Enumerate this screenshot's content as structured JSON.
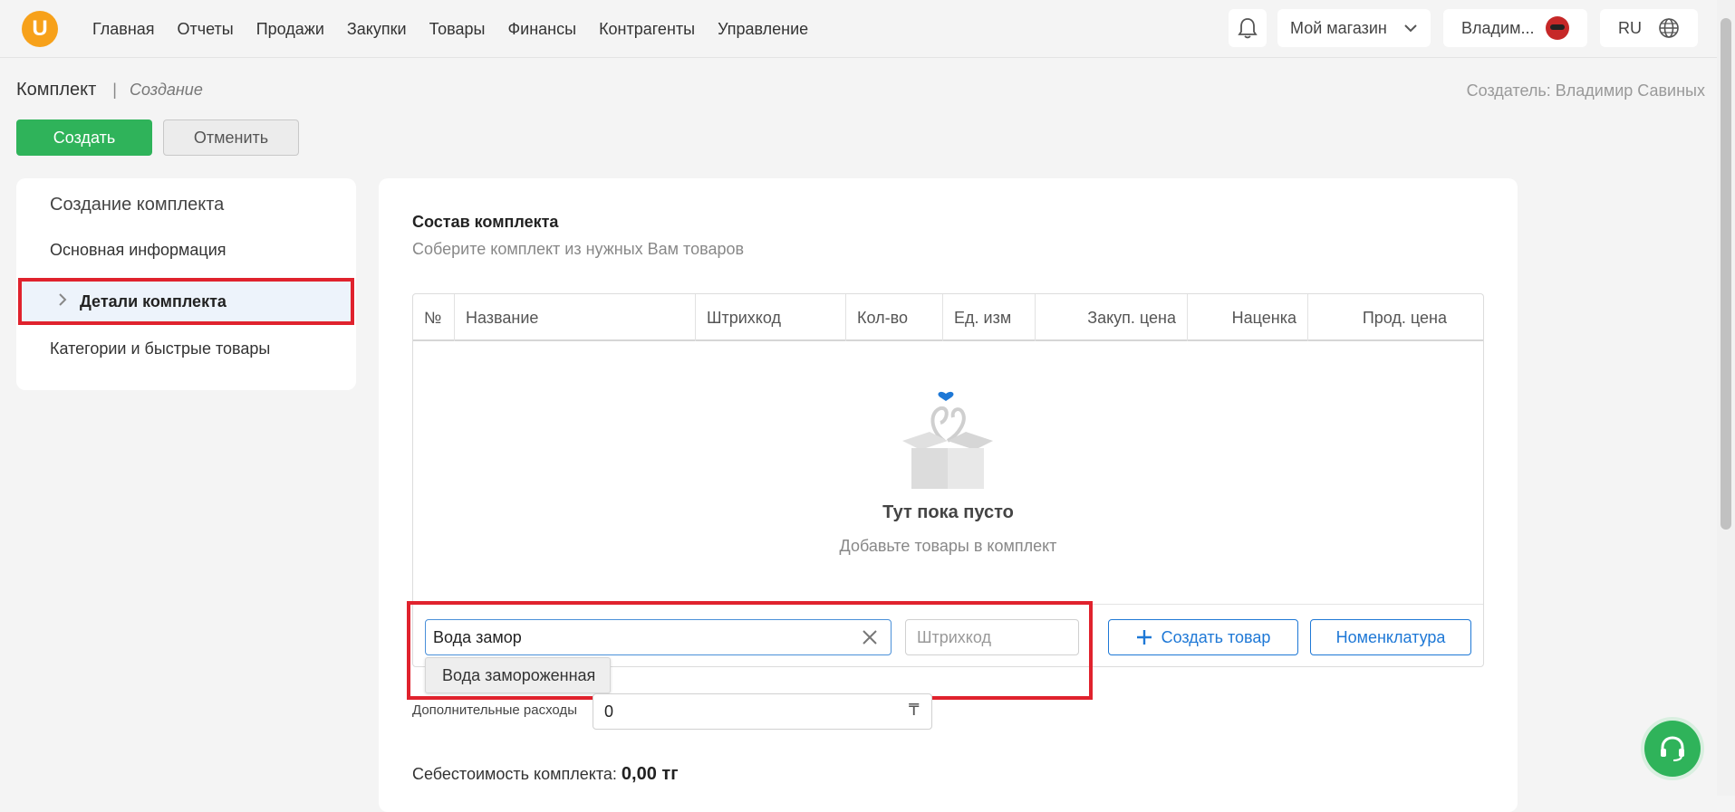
{
  "app": {
    "logo_letter": "U",
    "nav": [
      "Главная",
      "Отчеты",
      "Продажи",
      "Закупки",
      "Товары",
      "Финансы",
      "Контрагенты",
      "Управление"
    ],
    "store": "Мой магазин",
    "user": "Владим...",
    "lang": "RU",
    "accent": "#2fb35a",
    "logo_color": "#f7a11a",
    "link_color": "#1e78d6",
    "highlight_color": "#e0222d"
  },
  "header": {
    "breadcrumb_main": "Комплект",
    "breadcrumb_sep": "|",
    "breadcrumb_sub": "Создание",
    "creator": "Создатель: Владимир Савиных",
    "create_label": "Создать",
    "cancel_label": "Отменить"
  },
  "sidebar": {
    "title": "Создание комплекта",
    "items": [
      "Основная информация",
      "Детали комплекта",
      "Категории и быстрые товары"
    ],
    "active_index": 1
  },
  "main": {
    "section_title": "Состав комплекта",
    "section_subtitle": "Соберите комплект из нужных Вам товаров",
    "columns": [
      "№",
      "Название",
      "Штрихкод",
      "Кол-во",
      "Ед. изм",
      "Закуп. цена",
      "Наценка",
      "Прод. цена"
    ],
    "empty_title": "Тут пока пусто",
    "empty_subtitle": "Добавьте товары в комплект",
    "search_value": "Вода замор",
    "barcode_placeholder": "Штрихкод",
    "suggestion": "Вода замороженная",
    "create_product_label": "Создать товар",
    "nomenclature_label": "Номенклатура",
    "extra_costs_label": "Дополнительные расходы",
    "extra_costs_value": "0",
    "currency_symbol": "₸",
    "cost_label": "Себестоимость комплекта:",
    "cost_value": "0,00 тг"
  }
}
